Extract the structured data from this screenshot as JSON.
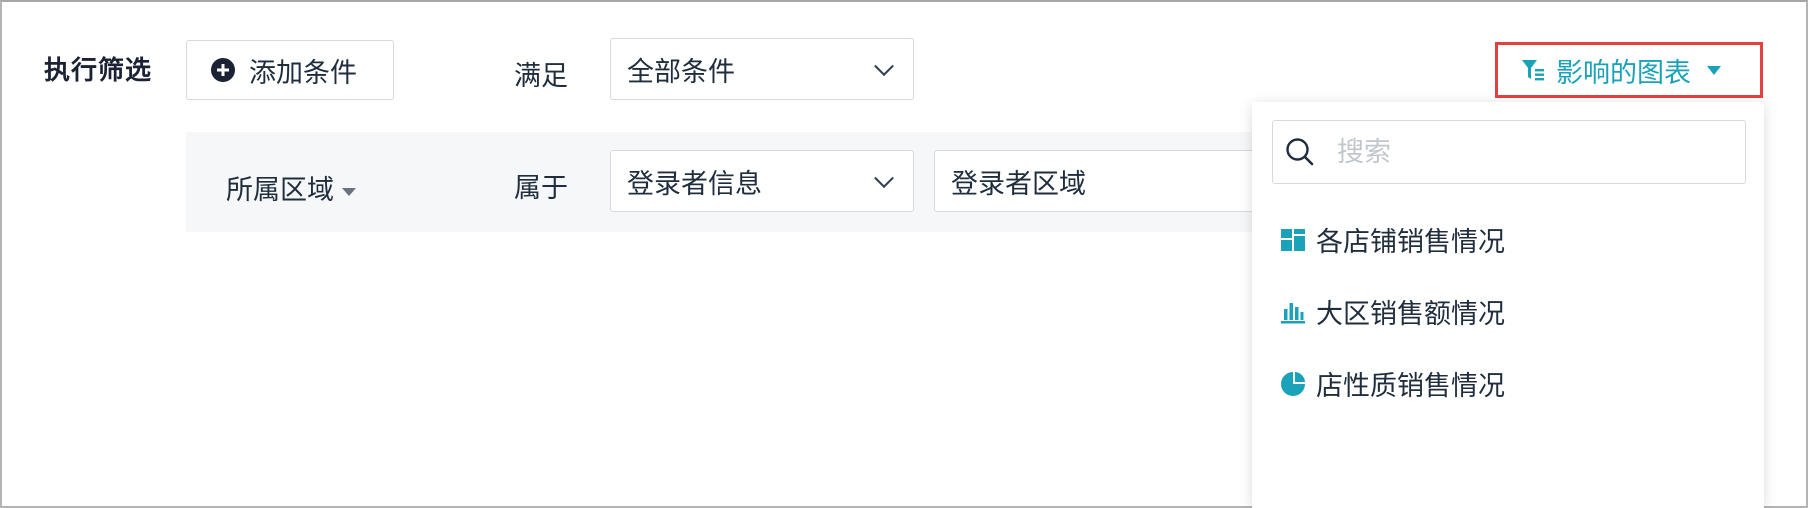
{
  "filter": {
    "exec_label": "执行筛选",
    "add_condition_label": "添加条件",
    "satisfy_label": "满足",
    "match_mode": "全部条件"
  },
  "condition": {
    "field": "所属区域",
    "operator": "属于",
    "source": "登录者信息",
    "value": "登录者区域"
  },
  "affect": {
    "label": "影响的图表",
    "accent": "#1aa3b8",
    "highlight": "#e54040"
  },
  "dropdown": {
    "search_placeholder": "搜索",
    "items": [
      {
        "label": "各店铺销售情况",
        "icon": "dashboard-icon"
      },
      {
        "label": "大区销售额情况",
        "icon": "bar-chart-icon"
      },
      {
        "label": "店性质销售情况",
        "icon": "pie-chart-icon"
      }
    ]
  }
}
